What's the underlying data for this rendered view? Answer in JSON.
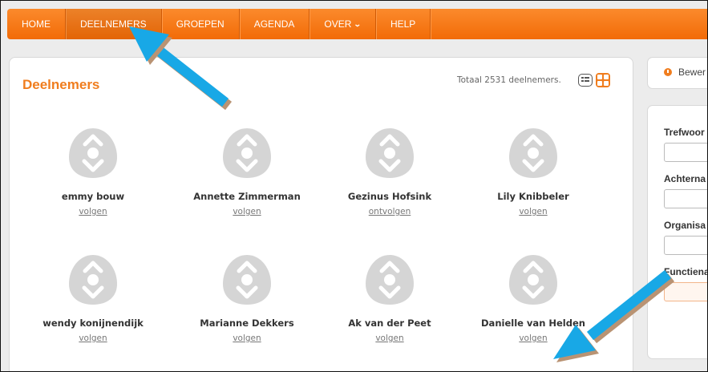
{
  "nav": {
    "items": [
      {
        "label": "HOME"
      },
      {
        "label": "DEELNEMERS"
      },
      {
        "label": "GROEPEN"
      },
      {
        "label": "AGENDA"
      },
      {
        "label": "OVER"
      },
      {
        "label": "HELP"
      }
    ]
  },
  "main": {
    "title": "Deelnemers",
    "totaal": "Totaal 2531 deelnemers.",
    "participants": [
      {
        "name": "emmy bouw",
        "action": "volgen"
      },
      {
        "name": "Annette Zimmerman",
        "action": "volgen"
      },
      {
        "name": "Gezinus Hofsink",
        "action": "ontvolgen"
      },
      {
        "name": "Lily Knibbeler",
        "action": "volgen"
      },
      {
        "name": "wendy konijnendijk",
        "action": "volgen"
      },
      {
        "name": "Marianne Dekkers",
        "action": "volgen"
      },
      {
        "name": "Ak van der Peet",
        "action": "volgen"
      },
      {
        "name": "Danielle van Helden",
        "action": "volgen"
      }
    ]
  },
  "sidebar": {
    "bewerken": "Bewer",
    "labels": [
      "Trefwoor",
      "Achterna",
      "Organisa",
      "Functiena"
    ]
  },
  "colors": {
    "accent": "#f07d1e",
    "nav": "#f26b07",
    "annotation_arrow": "#19a9e6"
  },
  "icons": [
    "chevron-down-icon",
    "list-view-icon",
    "grid-view-icon",
    "edit-icon",
    "avatar-placeholder-icon"
  ]
}
